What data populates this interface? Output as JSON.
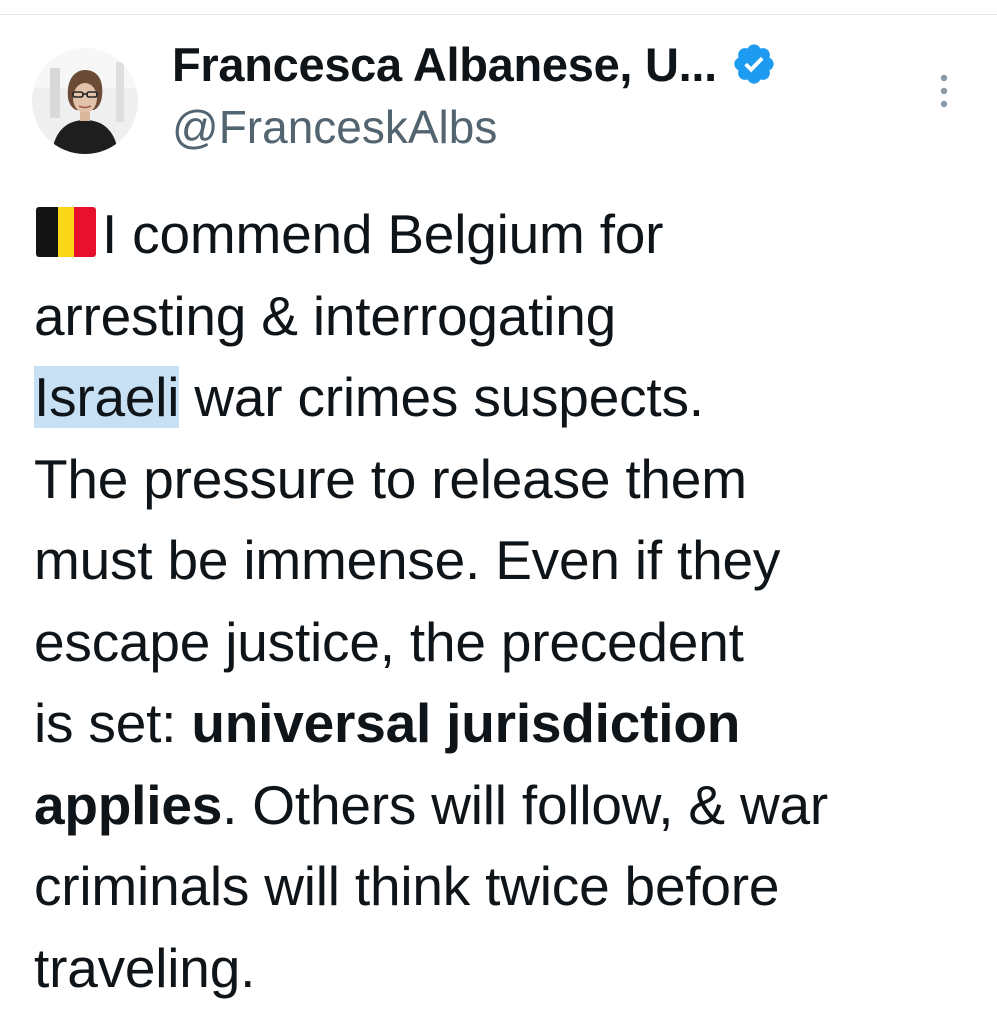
{
  "author": {
    "display_name": "Francesca Albanese, U...",
    "handle": "@FranceskAlbs",
    "verified": true,
    "verified_color": "#1d9bf0"
  },
  "menu": {
    "icon": "more-vertical-icon"
  },
  "tweet": {
    "flag_emoji": "belgium-flag",
    "line1": "I commend Belgium for",
    "line2": "arresting & interrogating",
    "line3_highlight": "Israeli",
    "line3_rest": " war crimes suspects.",
    "line4": "The pressure to release them",
    "line5": "must be immense. Even if they",
    "line6": "escape justice, the precedent",
    "line7_normal": "is set: ",
    "line7_bold": "universal jurisdiction",
    "line8_bold": "applies",
    "line8_rest": ". Others will follow, & war",
    "line9": "criminals will think twice before",
    "line10": "traveling."
  },
  "colors": {
    "text": "#0f1419",
    "secondary_text": "#536471",
    "selection_highlight": "#c7e0f4"
  }
}
